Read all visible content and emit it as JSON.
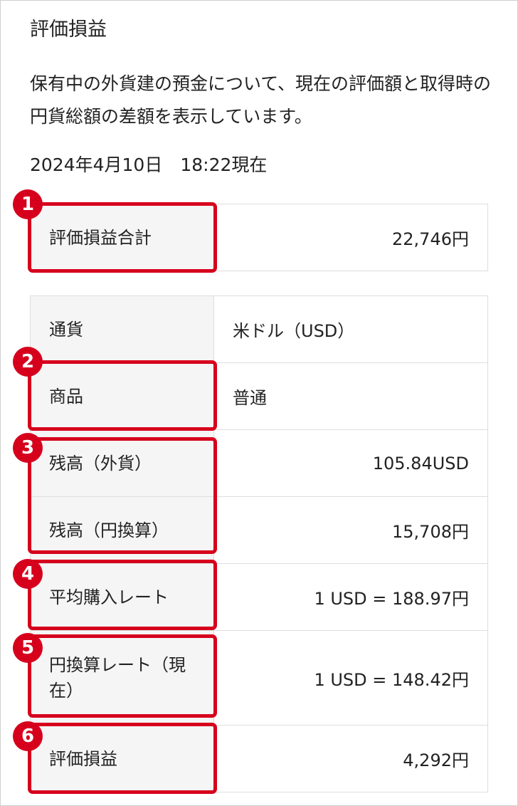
{
  "header": {
    "title": "評価損益",
    "description": "保有中の外貨建の預金について、現在の評価額と取得時の円貨総額の差額を表示しています。",
    "timestamp": "2024年4月10日　18:22現在"
  },
  "total": {
    "label": "評価損益合計",
    "value": "22,746円"
  },
  "rows": [
    {
      "label": "通貨",
      "value": "米ドル（USD）"
    },
    {
      "label": "商品",
      "value": "普通"
    },
    {
      "label": "残高（外貨）",
      "value": "105.84USD"
    },
    {
      "label": "残高（円換算）",
      "value": "15,708円"
    },
    {
      "label": "平均購入レート",
      "value": "1 USD = 188.97円"
    },
    {
      "label": "円換算レート（現在）",
      "value": "1 USD = 148.42円"
    },
    {
      "label": "評価損益",
      "value": "4,292円"
    }
  ],
  "markers": [
    "1",
    "2",
    "3",
    "4",
    "5",
    "6"
  ],
  "colors": {
    "marker": "#d6001c",
    "label_background": "#f5f5f5",
    "border": "#dedede"
  }
}
